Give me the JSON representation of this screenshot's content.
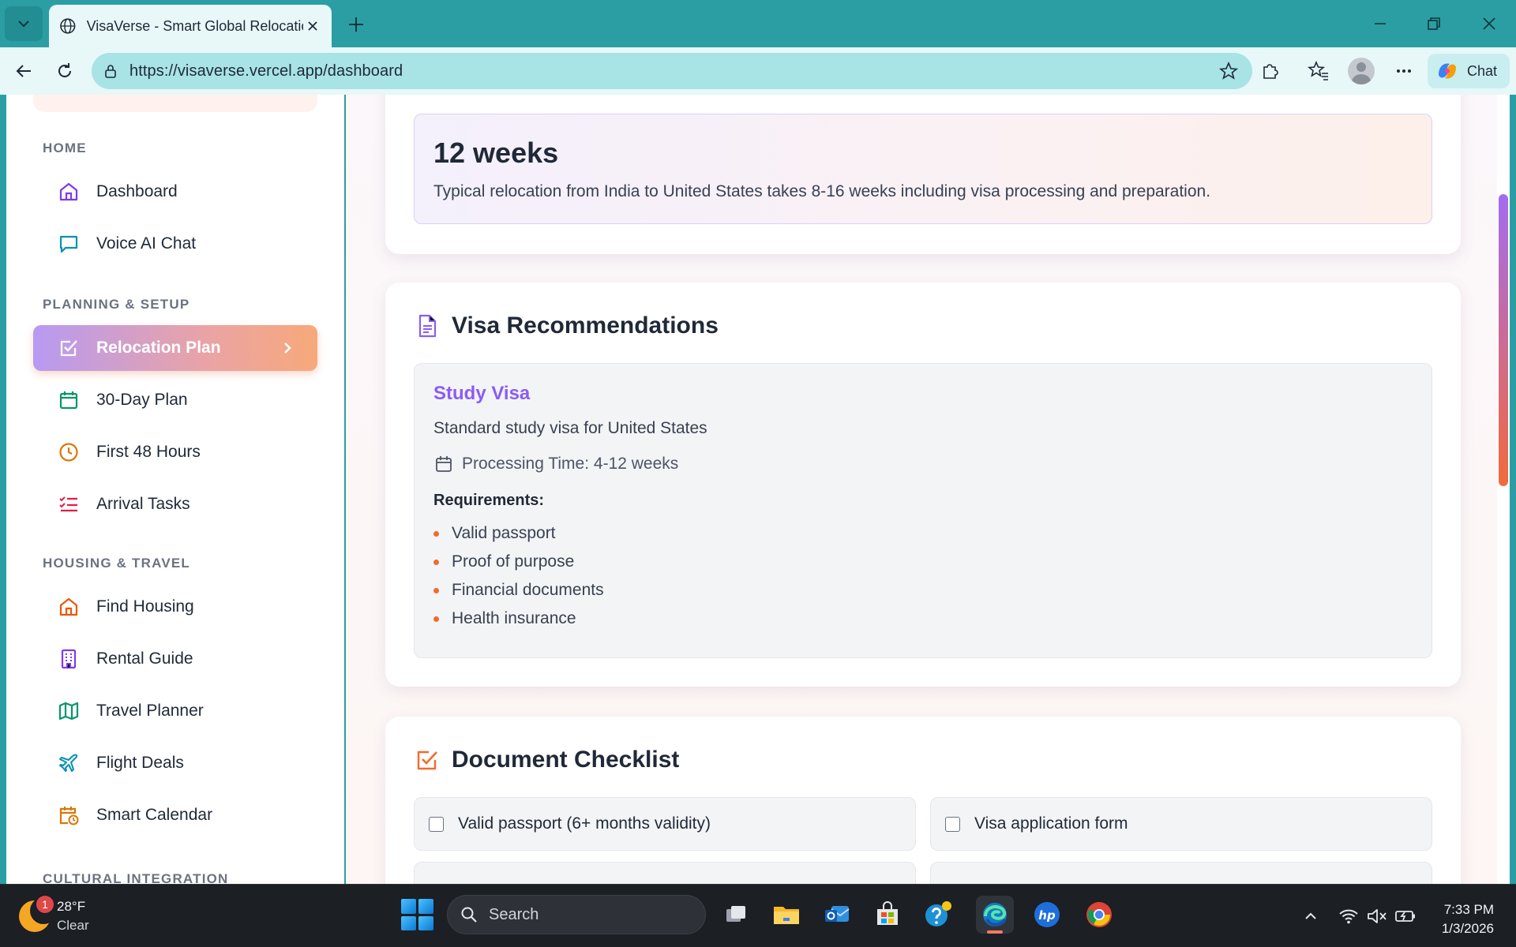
{
  "browser": {
    "tab_title": "VisaVerse - Smart Global Relocation",
    "url": "https://visaverse.vercel.app/dashboard",
    "chat_label": "Chat"
  },
  "sidebar": {
    "sections": [
      {
        "title": "HOME",
        "items": [
          {
            "label": "Dashboard",
            "icon": "home-icon",
            "color": "#7c3aed"
          },
          {
            "label": "Voice AI Chat",
            "icon": "chat-bubble-icon",
            "color": "#0891b2"
          }
        ]
      },
      {
        "title": "PLANNING & SETUP",
        "items": [
          {
            "label": "Relocation Plan",
            "icon": "checkbox-edit-icon",
            "active": true
          },
          {
            "label": "30-Day Plan",
            "icon": "calendar-icon",
            "color": "#059669"
          },
          {
            "label": "First 48 Hours",
            "icon": "clock-icon",
            "color": "#d97706"
          },
          {
            "label": "Arrival Tasks",
            "icon": "checklist-icon",
            "color": "#e11d48"
          }
        ]
      },
      {
        "title": "HOUSING & TRAVEL",
        "items": [
          {
            "label": "Find Housing",
            "icon": "house-icon",
            "color": "#ea580c"
          },
          {
            "label": "Rental Guide",
            "icon": "building-icon",
            "color": "#7c3aed"
          },
          {
            "label": "Travel Planner",
            "icon": "map-icon",
            "color": "#059669"
          },
          {
            "label": "Flight Deals",
            "icon": "plane-icon",
            "color": "#0891b2"
          },
          {
            "label": "Smart Calendar",
            "icon": "calendar-clock-icon",
            "color": "#d97706"
          }
        ]
      },
      {
        "title": "CULTURAL INTEGRATION",
        "items": []
      }
    ]
  },
  "timeline": {
    "duration": "12 weeks",
    "description": "Typical relocation from India to United States takes 8-16 weeks including visa processing and preparation."
  },
  "visa": {
    "heading": "Visa Recommendations",
    "name": "Study Visa",
    "description": "Standard study visa for United States",
    "processing": "Processing Time: 4-12 weeks",
    "requirements_title": "Requirements:",
    "requirements": [
      "Valid passport",
      "Proof of purpose",
      "Financial documents",
      "Health insurance"
    ]
  },
  "documents": {
    "heading": "Document Checklist",
    "items": [
      "Valid passport (6+ months validity)",
      "Visa application form",
      "",
      ""
    ]
  },
  "taskbar": {
    "weather_badge": "1",
    "temperature": "28°F",
    "condition": "Clear",
    "search_label": "Search",
    "time": "7:33 PM",
    "date": "1/3/2026"
  },
  "colors": {
    "accent_purple": "#8b5cf6",
    "accent_orange": "#f26b2a",
    "browser_teal": "#2b9ea3"
  }
}
